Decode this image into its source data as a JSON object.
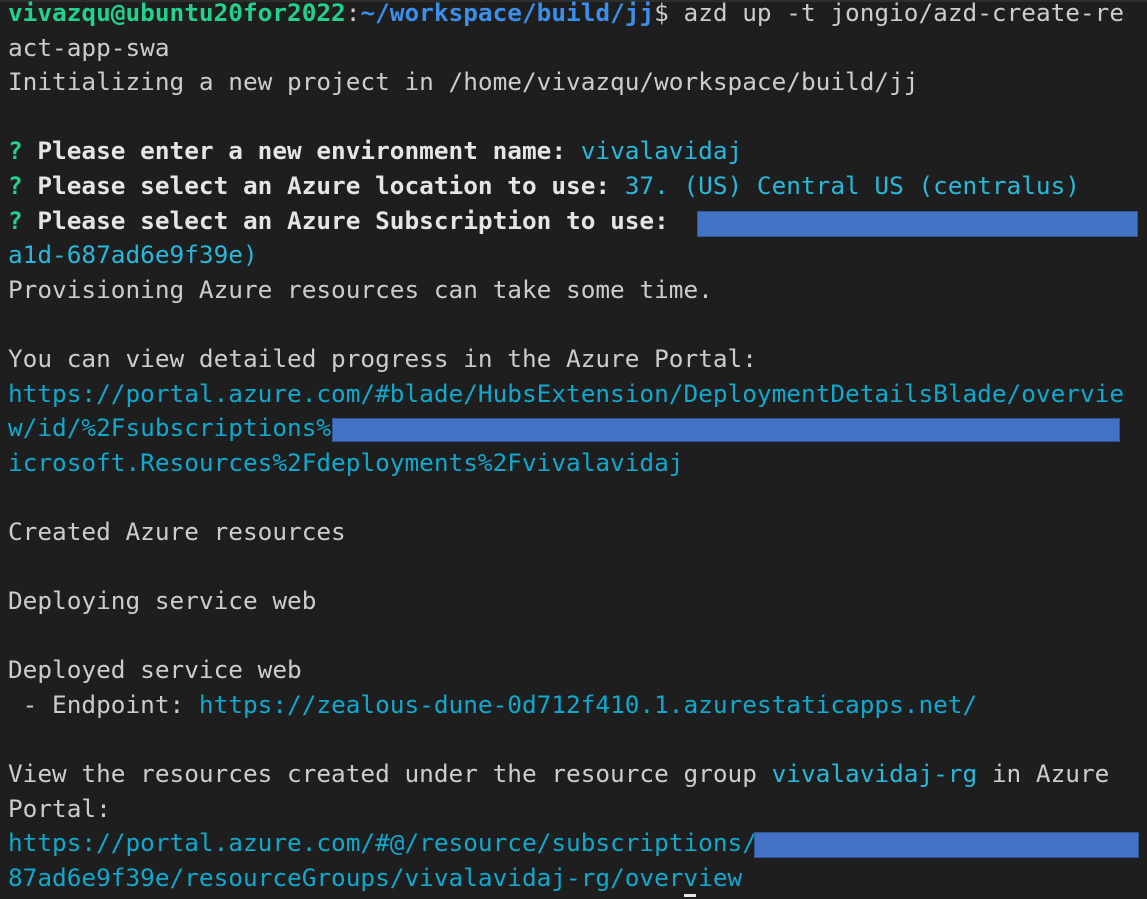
{
  "terminal": {
    "prompt_user": "vivazqu@ubuntu20for2022",
    "prompt_sep": ":",
    "prompt_path": "~/workspace/build/jj",
    "prompt_symbol": "$",
    "command_line1": " azd up -t jongio/azd-create-re",
    "command_line2": "act-app-swa",
    "init_message": "Initializing a new project in /home/vivazqu/workspace/build/jj",
    "questions": {
      "env": {
        "mark": "?",
        "text": " Please enter a new environment name: ",
        "answer": "vivalavidaj"
      },
      "location": {
        "mark": "?",
        "text": " Please select an Azure location to use: ",
        "answer": "37. (US) Central US (centralus)"
      },
      "subscription": {
        "mark": "?",
        "text": " Please select an Azure Subscription to use: ",
        "answer_tail": "a1d-687ad6e9f39e)"
      }
    },
    "provisioning_note": "Provisioning Azure resources can take some time.",
    "progress_intro": "You can view detailed progress in the Azure Portal:",
    "progress_url_line1": "https://portal.azure.com/#blade/HubsExtension/DeploymentDetailsBlade/overvie",
    "progress_url_line2_start": "w/id/%2Fsubscriptions%",
    "progress_url_line3": "icrosoft.Resources%2Fdeployments%2Fvivalavidaj",
    "created_message": "Created Azure resources",
    "deploying_message": "Deploying service web",
    "deployed_message": "Deployed service web",
    "endpoint_label": " - Endpoint: ",
    "endpoint_url": "https://zealous-dune-0d712f410.1.azurestaticapps.net/",
    "view_resources_prefix": "View the resources created under the resource group ",
    "resource_group": "vivalavidaj-rg",
    "view_resources_suffix": " in Azure",
    "portal_label": "Portal:",
    "resources_url_line1_start": "https://portal.azure.com/#@/resource/subscriptions/",
    "resources_url_line2": "87ad6e9f39e/resourceGroups/vivalavidaj-rg/overview"
  },
  "colors": {
    "background": "#1e1e1e",
    "text": "#cccccc",
    "prompt_user": "#23d18b",
    "prompt_path": "#3b8eea",
    "answer": "#29b8db",
    "link": "#11a8cd",
    "redaction": "#4472c4"
  }
}
